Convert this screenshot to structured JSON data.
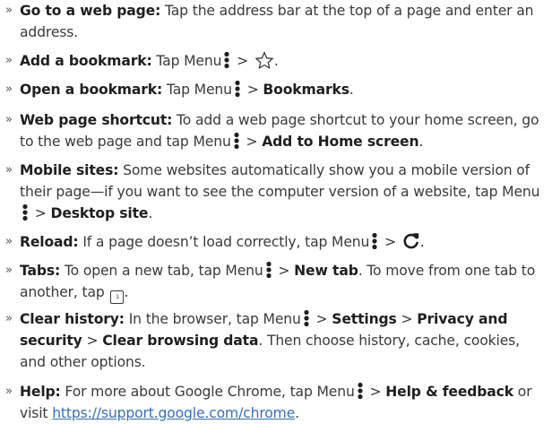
{
  "items": [
    {
      "title": "Go to a web page:",
      "text": " Tap the address bar at the top of a page and enter an address."
    },
    {
      "title": "Add a bookmark:",
      "pre": " Tap Menu",
      "sep": " > ",
      "icon": "star-outline-icon",
      "post": "."
    },
    {
      "title": "Open a bookmark:",
      "pre": " Tap Menu",
      "sep": " > ",
      "target": "Bookmarks",
      "post": "."
    },
    {
      "title": "Web page shortcut:",
      "pre": " To add a web page shortcut to your home screen, go to the web page and tap Menu",
      "sep": " > ",
      "target": "Add to Home screen",
      "post": "."
    },
    {
      "title": "Mobile sites:",
      "pre": " Some websites automatically show you a mobile version of their page—if you want to see the computer version of a website, tap Menu",
      "sep": " > ",
      "target": "Desktop site",
      "post": "."
    },
    {
      "title": "Reload:",
      "pre": " If a page doesn’t load correctly, tap Menu",
      "sep": " > ",
      "icon": "reload-icon",
      "post": "."
    },
    {
      "title": "Tabs:",
      "pre": " To open a new tab, tap Menu",
      "sep": " > ",
      "target": "New tab",
      "mid": ". To move from one tab to another, tap ",
      "tab_count": "1",
      "post": "."
    },
    {
      "title": "Clear history:",
      "pre": " In the browser, tap Menu",
      "sep1": " > ",
      "target1": "Settings",
      "sep2": " > ",
      "target2": "Privacy and security",
      "sep3": " > ",
      "target3": "Clear browsing data",
      "post": ". Then choose history, cache, cookies, and other options."
    },
    {
      "title": "Help:",
      "pre": " For more about Google Chrome, tap Menu",
      "sep": " > ",
      "target": "Help & feedback",
      "mid": " or visit ",
      "link": "https://support.google.com/chrome",
      "post": "."
    }
  ],
  "bullet_symbol": "»",
  "colors": {
    "text": "#3a3a3a",
    "bold": "#1f1f1f",
    "link": "#3a6fb4"
  }
}
